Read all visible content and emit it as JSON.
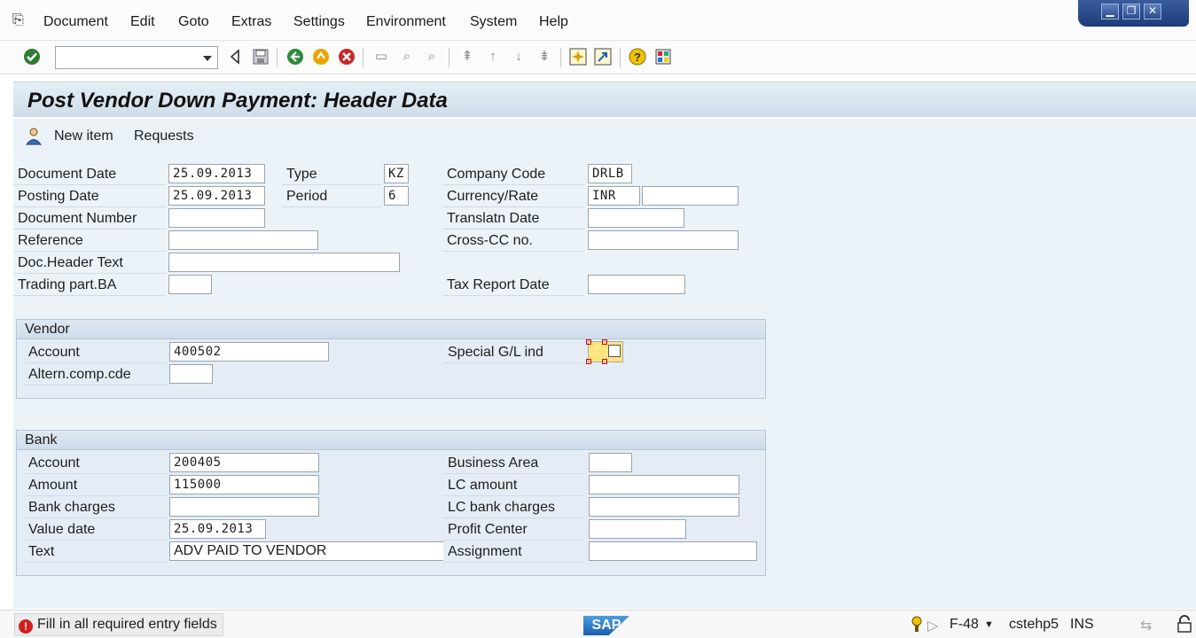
{
  "menubar": {
    "items": [
      "Document",
      "Edit",
      "Goto",
      "Extras",
      "Settings",
      "Environment",
      "System",
      "Help"
    ]
  },
  "window_controls": {
    "minimize": "▁",
    "restore": "❐",
    "close": "✕"
  },
  "toolbar": {
    "command_field_value": ""
  },
  "title": "Post Vendor Down Payment: Header Data",
  "app_toolbar": {
    "new_item": "New item",
    "requests": "Requests"
  },
  "header": {
    "document_date_label": "Document Date",
    "document_date": "25.09.2013",
    "type_label": "Type",
    "type": "KZ",
    "company_code_label": "Company Code",
    "company_code": "DRLB",
    "posting_date_label": "Posting Date",
    "posting_date": "25.09.2013",
    "period_label": "Period",
    "period": "6",
    "currency_rate_label": "Currency/Rate",
    "currency": "INR",
    "rate": "",
    "document_number_label": "Document Number",
    "document_number": "",
    "translatn_date_label": "Translatn Date",
    "translatn_date": "",
    "reference_label": "Reference",
    "reference": "",
    "cross_cc_label": "Cross-CC no.",
    "cross_cc": "",
    "doc_header_text_label": "Doc.Header Text",
    "doc_header_text": "",
    "trading_part_label": "Trading part.BA",
    "trading_part": "",
    "tax_report_date_label": "Tax Report Date",
    "tax_report_date": ""
  },
  "vendor": {
    "title": "Vendor",
    "account_label": "Account",
    "account": "400502",
    "altern_comp_label": "Altern.comp.cde",
    "altern_comp": "",
    "special_gl_label": "Special G/L ind",
    "special_gl": ""
  },
  "bank": {
    "title": "Bank",
    "account_label": "Account",
    "account": "200405",
    "business_area_label": "Business Area",
    "business_area": "",
    "amount_label": "Amount",
    "amount": "115000",
    "lc_amount_label": "LC amount",
    "lc_amount": "",
    "bank_charges_label": "Bank charges",
    "bank_charges": "",
    "lc_bank_charges_label": "LC bank charges",
    "lc_bank_charges": "",
    "value_date_label": "Value date",
    "value_date": "25.09.2013",
    "profit_center_label": "Profit Center",
    "profit_center": "",
    "text_label": "Text",
    "text": "ADV PAID TO VENDOR",
    "assignment_label": "Assignment",
    "assignment": ""
  },
  "statusbar": {
    "message": "Fill in all required entry fields",
    "logo": "SAP",
    "transaction": "F-48",
    "server": "cstehp5",
    "mode": "INS"
  },
  "colors": {
    "title_bg": "#cfdde9",
    "form_bg": "#ebf2f8",
    "error_red": "#d21f1f",
    "sap_blue": "#1b5fb0"
  }
}
